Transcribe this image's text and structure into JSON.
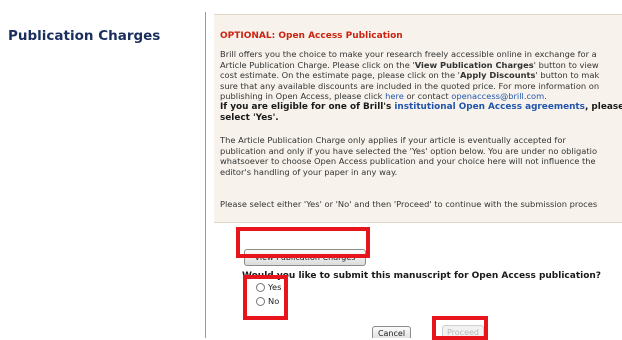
{
  "section": {
    "title": "Publication Charges"
  },
  "notice": {
    "title": "OPTIONAL: Open Access Publication",
    "p1": {
      "l1": "Brill offers you the choice to make your research freely accessible online in exchange for a",
      "l2a": "Article Publication Charge. Please click on the '",
      "l2b": "View Publication Charges",
      "l2c": "' button to view",
      "l3a": "cost estimate. On the estimate page, please click on the '",
      "l3b": "Apply Discounts",
      "l3c": "' button to mak",
      "l4": "sure that any available discounts are included in the quoted price. For more information on",
      "l5a": "publishing in Open Access, please click ",
      "l5link": "here",
      "l5b": " or contact ",
      "l5email": "openaccess@brill.com",
      "l5c": "."
    },
    "p2": {
      "l1a": "If you are eligible for one of Brill's ",
      "l1link": "institutional Open Access agreements",
      "l1b": ", please",
      "l2": "select 'Yes'."
    },
    "p3": {
      "l1": "The Article Publication Charge only applies if your article is eventually accepted for",
      "l2": "publication and only if you have selected the 'Yes' option below. You are under no obligatio",
      "l3": "whatsoever to choose Open Access publication and your choice here will not influence the",
      "l4": "editor's handling of your paper in any way."
    },
    "p4": "Please select either 'Yes' or 'No' and then 'Proceed' to continue with the submission proces"
  },
  "buttons": {
    "view_charges": "View Publication Charges",
    "cancel": "Cancel",
    "proceed": "Proceed"
  },
  "question": "Would you like to submit this manuscript for Open Access publication?",
  "options": {
    "yes": "Yes",
    "no": "No"
  },
  "colors": {
    "highlight": "#e8141b",
    "notice_title": "#cc2211",
    "link": "#2255aa",
    "section_title": "#1b2f5e"
  }
}
